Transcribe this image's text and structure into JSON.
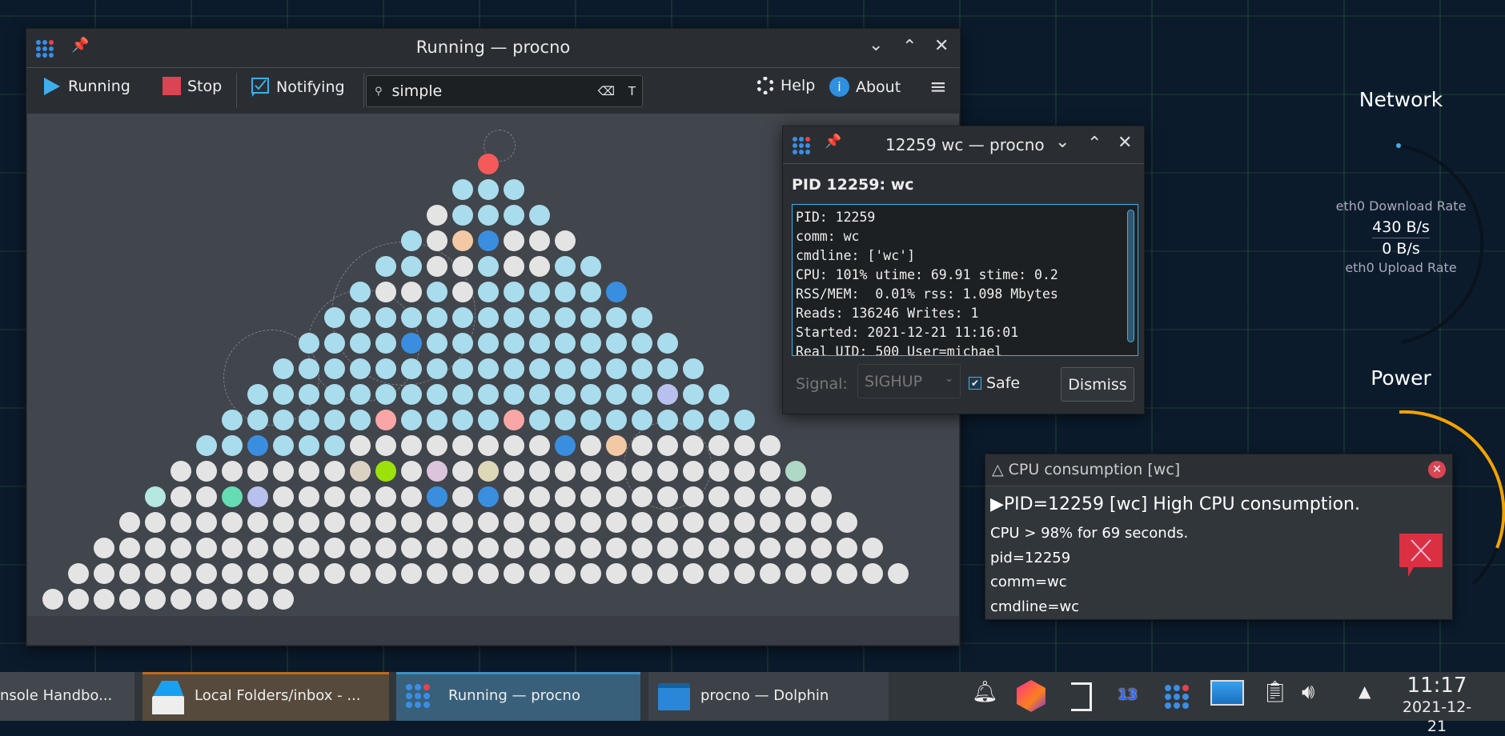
{
  "main_window": {
    "title": "Running — procno",
    "toolbar": {
      "running_label": "Running",
      "stop_label": "Stop",
      "notifying_label": "Notifying",
      "search_value": "simple",
      "help_label": "Help",
      "about_label": "About"
    },
    "process_rows": [
      "r",
      "bbb",
      "gbbbb",
      "bgoBggg",
      "bbggbggbb",
      "bggbgbbbbbB",
      "bbbbbbbbbbbbb",
      "bbbbBbbbbbbbbbb",
      "bbbbbbbbbbbbbbbbb",
      "bbbbbbbbbbbbbbbbvbb",
      "bbbbbbpbbbbpbbbbbbbbb",
      "bbBbbbggggggggBgogggggg",
      "gggggggtlgqgkgggggggggggm",
      "aggevggggggBgBggggggggggggg",
      "ggggggggggggggggggggggggggggg",
      "ggggggggggggggggggggggggggggggg",
      "ggggggggggggggggggggggggggggggggg",
      "gggggggggg"
    ],
    "color_codes": {
      "r": "#f45a5a",
      "b": "#a9dcec",
      "g": "#e4e4e4",
      "B": "#3a8ee0",
      "o": "#f2c9a4",
      "p": "#f8a6a6",
      "v": "#b8c0ee",
      "t": "#dcd2c4",
      "l": "#9ce20a",
      "q": "#dcc4dc",
      "k": "#dcd8b8",
      "m": "#b0d8c6",
      "a": "#b4e8e0",
      "e": "#66dcb4"
    }
  },
  "detail_window": {
    "title": "12259 wc — procno",
    "heading": "PID 12259: wc",
    "lines": [
      "PID: 12259",
      "comm: wc",
      "cmdline: ['wc']",
      "CPU: 101% utime: 69.91 stime: 0.2",
      "RSS/MEM:  0.01% rss: 1.098 Mbytes",
      "Reads: 136246 Writes: 1",
      "Started: 2021-12-21 11:16:01",
      "Real UID: 500 User=michael"
    ],
    "signal_label": "Signal:",
    "signal_value": "SIGHUP",
    "safe_label": "Safe",
    "safe_checked": true,
    "dismiss_label": "Dismiss"
  },
  "notification": {
    "title": "△ CPU consumption [wc]",
    "headline": "▶PID=12259 [wc] High CPU consumption.",
    "lines": [
      "CPU > 98% for 69 seconds.",
      "pid=12259",
      "comm=wc",
      "cmdline=wc"
    ]
  },
  "widgets": {
    "network_title": "Network",
    "download_label": "eth0 Download Rate",
    "download_value": "430 B/s",
    "upload_value": "0 B/s",
    "upload_label": "eth0 Upload Rate",
    "power_title": "Power"
  },
  "taskbar": {
    "tasks": [
      {
        "label": "nsole Handbo..."
      },
      {
        "label": "Local Folders/inbox - ..."
      },
      {
        "label": "Running — procno"
      },
      {
        "label": "procno — Dolphin"
      }
    ],
    "badge": "13",
    "time": "11:17",
    "date": "2021-12-21"
  }
}
